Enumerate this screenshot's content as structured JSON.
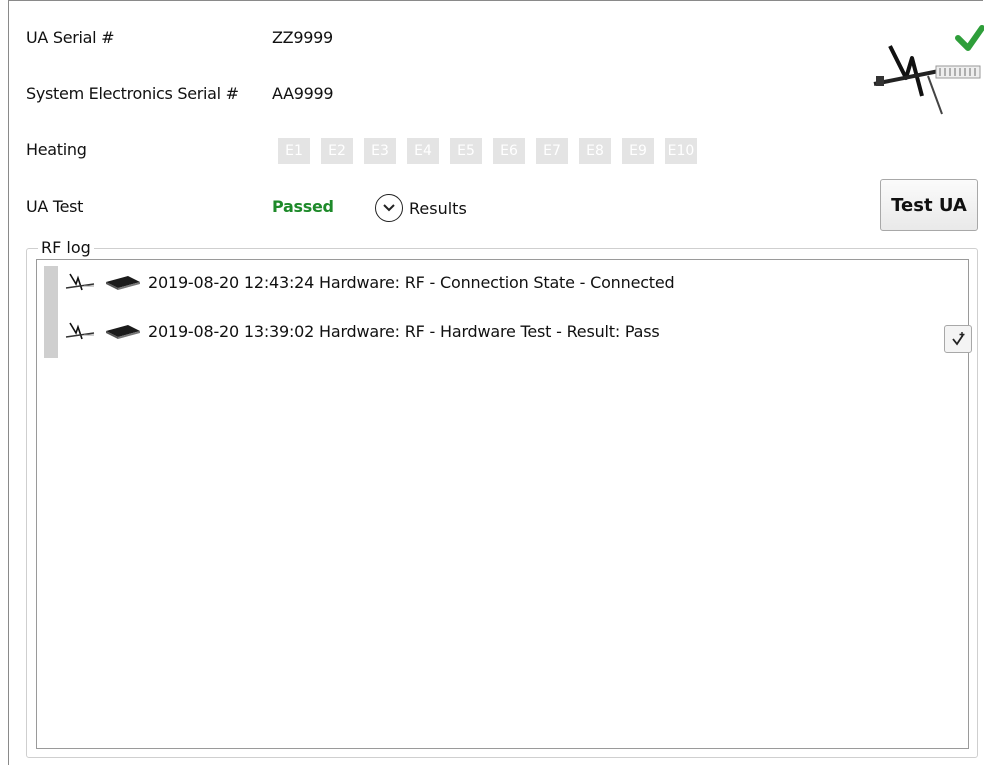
{
  "fields": {
    "ua_serial_label": "UA Serial #",
    "ua_serial_value": "ZZ9999",
    "sys_serial_label": "System Electronics Serial #",
    "sys_serial_value": "AA9999",
    "heating_label": "Heating",
    "ua_test_label": "UA Test",
    "ua_test_status": "Passed",
    "results_label": "Results"
  },
  "heaters": [
    "E1",
    "E2",
    "E3",
    "E4",
    "E5",
    "E6",
    "E7",
    "E8",
    "E9",
    "E10"
  ],
  "buttons": {
    "test_ua": "Test UA"
  },
  "rf_log": {
    "title": "RF log",
    "entries": [
      {
        "text": "2019-08-20 12:43:24 Hardware: RF - Connection State - Connected"
      },
      {
        "text": "2019-08-20 13:39:02 Hardware: RF - Hardware Test - Result: Pass"
      }
    ]
  },
  "colors": {
    "passed": "#1e8a2a",
    "check": "#2e9e3a",
    "heater_off": "#e4e4e4"
  },
  "icons": {
    "status": "ua-status-icon",
    "check": "check-icon",
    "entry_probe": "probe-icon",
    "entry_chip": "chip-icon",
    "results": "chevron-down-circle-icon",
    "scroll": "scroll-to-bottom-icon"
  }
}
